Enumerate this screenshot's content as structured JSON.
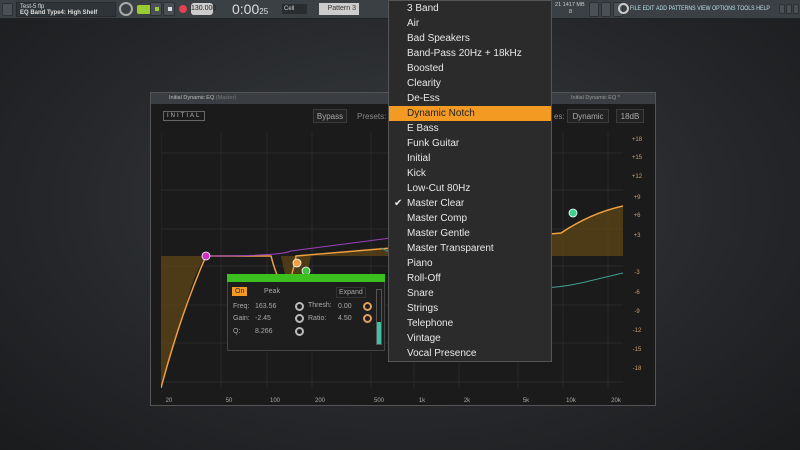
{
  "topbar": {
    "hint_line1": "Test-5 flp",
    "hint_line2": "EQ Band Type4: High Shelf",
    "tempo": "130.000",
    "time": "0:00",
    "time_small": "25",
    "snap": "Cell",
    "pattern": "Pattern 3",
    "cpu": "21",
    "mem": "1417 MB",
    "poly": "8",
    "menu": [
      "FILE",
      "EDIT",
      "ADD",
      "PATTERNS",
      "VIEW",
      "OPTIONS",
      "TOOLS",
      "HELP"
    ]
  },
  "window": {
    "title": "Initial Dynamic EQ",
    "title_suffix": "(Master)",
    "right_title": "Initial Dynamic EQ *"
  },
  "plugin": {
    "logo": "INITIAL",
    "bypass": "Bypass",
    "presets_label": "Presets:",
    "mode_label": "es:",
    "mode_value": "Dynamic",
    "range_value": "18dB",
    "db_labels": [
      "+18",
      "+15",
      "+12",
      "+9",
      "+6",
      "+3",
      "-3",
      "-6",
      "-9",
      "-12",
      "-15",
      "-18"
    ],
    "freq_labels": [
      "20",
      "50",
      "100",
      "200",
      "500",
      "1k",
      "2k",
      "5k",
      "10k",
      "20k"
    ],
    "band": {
      "on": "On",
      "type": "Peak",
      "mode": "Expand",
      "freq_label": "Freq:",
      "freq": "163.56",
      "gain_label": "Gain:",
      "gain": "-2.45",
      "q_label": "Q:",
      "q": "8.266",
      "thresh_label": "Thresh:",
      "thresh": "0.00",
      "ratio_label": "Ratio:",
      "ratio": "4.50"
    }
  },
  "presets": {
    "items": [
      "3 Band",
      "Air",
      "Bad Speakers",
      "Band-Pass 20Hz + 18kHz",
      "Boosted",
      "Clearity",
      "De-Ess",
      "Dynamic Notch",
      "E Bass",
      "Funk Guitar",
      "Initial",
      "Kick",
      "Low-Cut 80Hz",
      "Master Clear",
      "Master Comp",
      "Master Gentle",
      "Master Transparent",
      "Piano",
      "Roll-Off",
      "Snare",
      "Strings",
      "Telephone",
      "Vintage",
      "Vocal Presence"
    ],
    "highlighted": "Dynamic Notch",
    "checked": "Master Clear"
  },
  "colors": {
    "accent": "#f29a22",
    "green": "#3cc020"
  }
}
